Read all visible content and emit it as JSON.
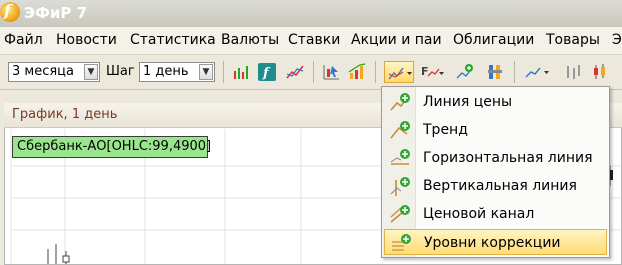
{
  "window": {
    "title": "ЭФиР 7",
    "icon": "efir-app-icon"
  },
  "menu": [
    "Файл",
    "Новости",
    "Статистика",
    "Валюты",
    "Ставки",
    "Акции и паи",
    "Облигации",
    "Товары",
    "Э"
  ],
  "toolbar": {
    "period_value": "3 месяца",
    "step_label": "Шаг",
    "step_value": "1 день",
    "buttons": [
      "candles-chart-icon",
      "function-icon",
      "line-chart-icon",
      "cursor-chart-icon",
      "bar-growth-icon",
      "draw-line-dropdown-icon",
      "price-type-icon",
      "add-point-icon",
      "indicator-icon",
      "line-series-icon",
      "ohlc-bars-icon",
      "candles-icon"
    ]
  },
  "chart": {
    "header_title": "График, 1 день",
    "ticker_label": "Сбербанк-АО[OHLC:99,4900]"
  },
  "dropdown": {
    "items": [
      {
        "label": "Линия цены",
        "icon": "price-line-icon"
      },
      {
        "label": "Тренд",
        "icon": "trend-icon"
      },
      {
        "label": "Горизонтальная линия",
        "icon": "horizontal-line-icon"
      },
      {
        "label": "Вертикальная линия",
        "icon": "vertical-line-icon"
      },
      {
        "label": "Ценовой канал",
        "icon": "price-channel-icon"
      },
      {
        "label": "Уровни коррекции",
        "icon": "correction-levels-icon"
      }
    ],
    "highlighted_index": 5
  },
  "colors": {
    "accent_highlight": "#ffdc74",
    "ticker_bg": "#9ae68e",
    "header_text": "#7a3a22"
  }
}
